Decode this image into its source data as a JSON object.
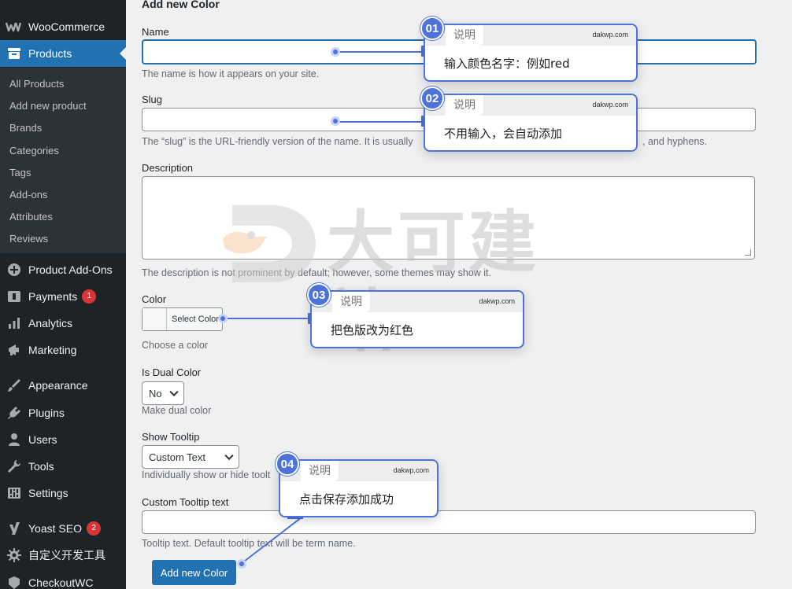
{
  "sidebar": {
    "brand": "WooCommerce",
    "current": "Products",
    "submenu": [
      "All Products",
      "Add new product",
      "Brands",
      "Categories",
      "Tags",
      "Add-ons",
      "Attributes",
      "Reviews"
    ],
    "items": [
      {
        "label": "Product Add-Ons",
        "icon": "plus-circle-icon"
      },
      {
        "label": "Payments",
        "icon": "payments-icon",
        "badge": "1"
      },
      {
        "label": "Analytics",
        "icon": "bar-chart-icon"
      },
      {
        "label": "Marketing",
        "icon": "megaphone-icon"
      },
      {
        "label": "Appearance",
        "icon": "brush-icon"
      },
      {
        "label": "Plugins",
        "icon": "plug-icon"
      },
      {
        "label": "Users",
        "icon": "user-icon"
      },
      {
        "label": "Tools",
        "icon": "wrench-icon"
      },
      {
        "label": "Settings",
        "icon": "sliders-icon"
      },
      {
        "label": "Yoast SEO",
        "icon": "yoast-icon",
        "badge": "2"
      },
      {
        "label": "自定义开发工具",
        "icon": "gear-icon"
      },
      {
        "label": "CheckoutWC",
        "icon": "checkout-icon"
      }
    ]
  },
  "form": {
    "title": "Add new Color",
    "name": {
      "label": "Name",
      "value": "",
      "desc": "The name is how it appears on your site."
    },
    "slug": {
      "label": "Slug",
      "value": "",
      "desc_left": "The “slug” is the URL-friendly version of the name. It is usually",
      "desc_right": ", and hyphens."
    },
    "description": {
      "label": "Description",
      "value": "",
      "desc": "The description is not prominent by default; however, some themes may show it."
    },
    "color": {
      "label": "Color",
      "button": "Select Color",
      "desc": "Choose a color"
    },
    "dual": {
      "label": "Is Dual Color",
      "selected": "No",
      "desc": "Make dual color"
    },
    "tooltip": {
      "label": "Show Tooltip",
      "selected": "Custom Text",
      "desc": "Individually show or hide toolt"
    },
    "tooltip_text": {
      "label": "Custom Tooltip text",
      "value": "",
      "desc": "Tooltip text. Default tooltip text will be term name."
    },
    "submit": "Add new Color"
  },
  "callouts": [
    {
      "num": "01",
      "title": "说明",
      "site": "dakwp.com",
      "text": "输入颜色名字：例如red"
    },
    {
      "num": "02",
      "title": "说明",
      "site": "dakwp.com",
      "text": "不用输入，会自动添加"
    },
    {
      "num": "03",
      "title": "说明",
      "site": "dakwp.com",
      "text": "把色版改为红色"
    },
    {
      "num": "04",
      "title": "说明",
      "site": "dakwp.com",
      "text": "点击保存添加成功"
    }
  ],
  "watermark": "大可建站",
  "colors": {
    "sidebar_bg": "#1d2327",
    "submenu_bg": "#2c3338",
    "accent": "#2271b1",
    "callout_blue": "#4d72db",
    "badge_red": "#d63638"
  }
}
